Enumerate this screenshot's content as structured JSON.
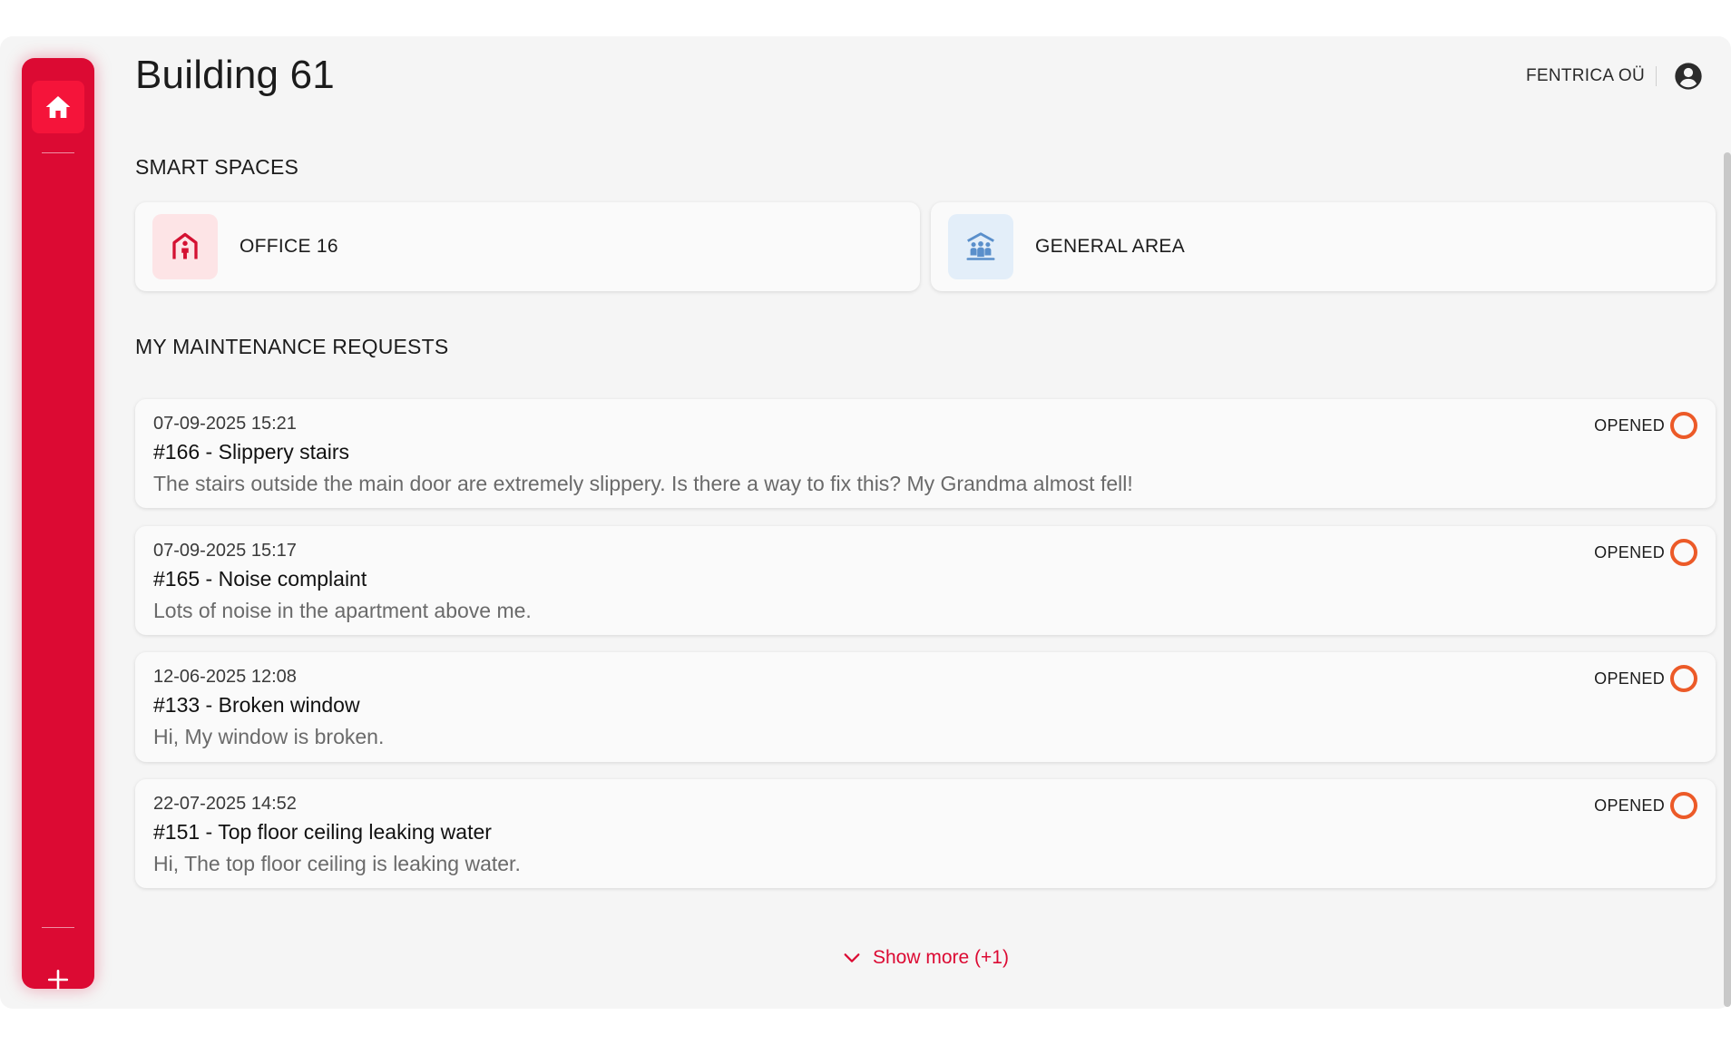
{
  "header": {
    "title": "Building 61",
    "org_name": "FENTRICA OÜ"
  },
  "icons": {
    "home": "home-icon",
    "add": "plus-icon",
    "account": "account-circle-icon",
    "office": "door-person-icon",
    "general": "people-group-icon",
    "show_more": "chevron-down-icon"
  },
  "colors": {
    "accent": "#dc0a33",
    "status_opened": "#ec5a28"
  },
  "smart_spaces": {
    "title": "SMART SPACES",
    "items": [
      {
        "label": "OFFICE 16"
      },
      {
        "label": "GENERAL AREA"
      }
    ]
  },
  "maintenance": {
    "title": "MY MAINTENANCE REQUESTS",
    "requests": [
      {
        "date": "07-09-2025 15:21",
        "title": "#166 - Slippery stairs",
        "description": "The stairs outside the main door are extremely slippery. Is there a way to fix this? My Grandma almost fell!",
        "status": "OPENED"
      },
      {
        "date": "07-09-2025 15:17",
        "title": "#165 - Noise complaint",
        "description": "Lots of noise in the apartment above me.",
        "status": "OPENED"
      },
      {
        "date": "12-06-2025 12:08",
        "title": "#133 - Broken window",
        "description": "Hi, My window is broken.",
        "status": "OPENED"
      },
      {
        "date": "22-07-2025 14:52",
        "title": "#151 - Top floor ceiling leaking water",
        "description": "Hi, The top floor ceiling is leaking water.",
        "status": "OPENED"
      }
    ],
    "show_more_label": "Show more (+1)"
  }
}
